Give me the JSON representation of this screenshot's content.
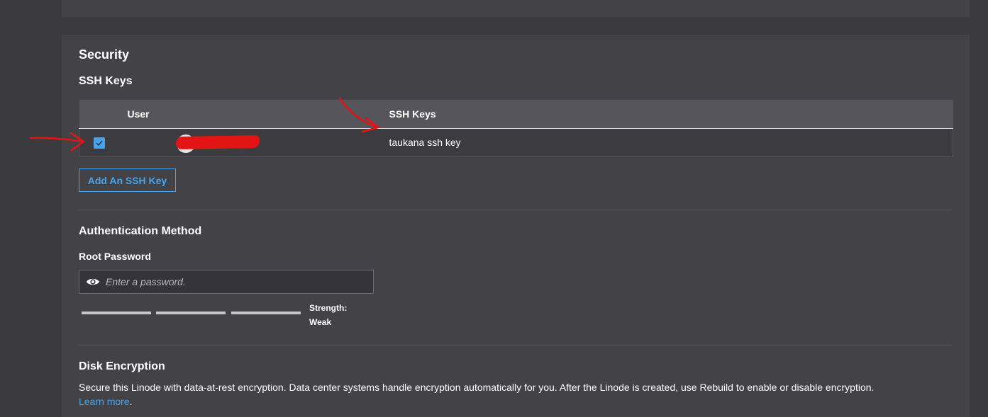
{
  "security": {
    "title": "Security",
    "ssh_keys": {
      "title": "SSH Keys",
      "columns": [
        "User",
        "SSH Keys"
      ],
      "rows": [
        {
          "checked": true,
          "user": "",
          "keys": "taukana ssh key"
        }
      ],
      "add_button": "Add An SSH Key"
    },
    "auth": {
      "title": "Authentication Method",
      "root_password_label": "Root Password",
      "password_placeholder": "Enter a password.",
      "strength_label": "Strength:",
      "strength_value": "Weak"
    },
    "disk": {
      "title": "Disk Encryption",
      "description": "Secure this Linode with data-at-rest encryption. Data center systems handle encryption automatically for you. After the Linode is created, use Rebuild to enable or disable encryption.",
      "learn_more": "Learn more",
      "period": "."
    }
  },
  "icons": {
    "checkbox": "check-icon",
    "password_toggle": "eye-icon"
  },
  "colors": {
    "accent": "#4aa3e8",
    "annotation": "#e21414",
    "page_bg": "#3a3a3f",
    "card_bg": "#424247"
  }
}
